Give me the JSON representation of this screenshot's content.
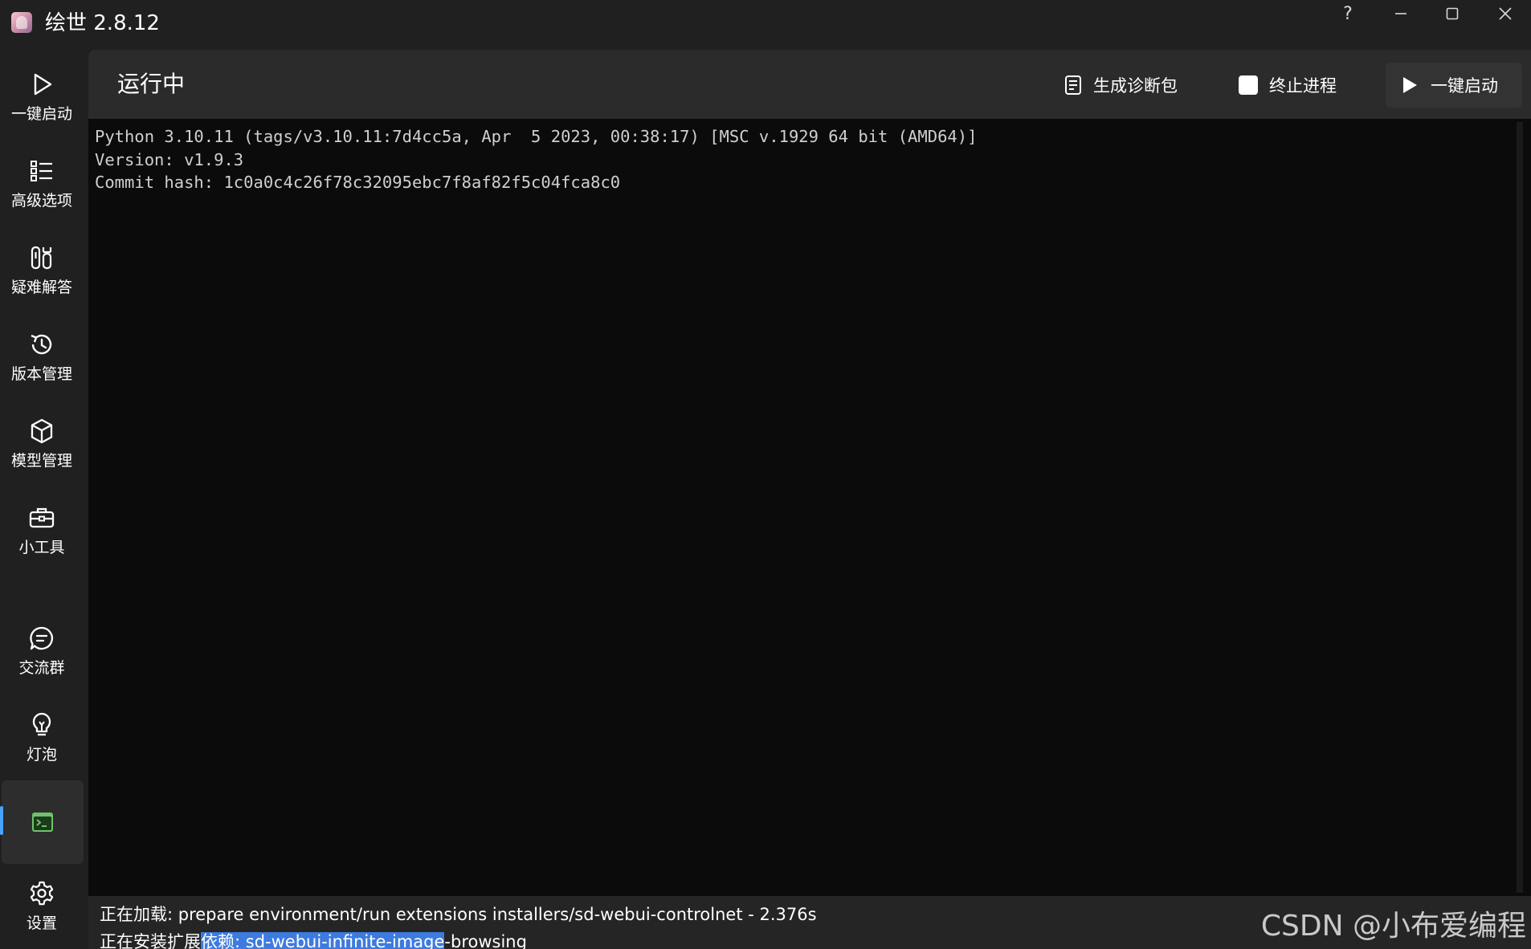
{
  "window": {
    "app_title": "绘世 2.8.12",
    "help_symbol": "?",
    "minimize_symbol": "—",
    "maximize_symbol": "□",
    "close_symbol": "✕"
  },
  "sidebar": {
    "items": [
      {
        "label": "一键启动",
        "icon": "play-icon"
      },
      {
        "label": "高级选项",
        "icon": "list-icon"
      },
      {
        "label": "疑难解答",
        "icon": "tools-icon"
      },
      {
        "label": "版本管理",
        "icon": "history-icon"
      },
      {
        "label": "模型管理",
        "icon": "cube-icon"
      },
      {
        "label": "小工具",
        "icon": "toolbox-icon"
      },
      {
        "label": "交流群",
        "icon": "chat-icon"
      },
      {
        "label": "灯泡",
        "icon": "lightbulb-icon"
      },
      {
        "label": "",
        "icon": "console-icon",
        "active": true
      },
      {
        "label": "设置",
        "icon": "gear-icon"
      }
    ]
  },
  "toolbar": {
    "title": "运行中",
    "diagnostics_label": "生成诊断包",
    "stop_label": "终止进程",
    "start_label": "一键启动"
  },
  "console": {
    "lines": [
      "Python 3.10.11 (tags/v3.10.11:7d4cc5a, Apr  5 2023, 00:38:17) [MSC v.1929 64 bit (AMD64)]",
      "Version: v1.9.3",
      "Commit hash: 1c0a0c4c26f78c32095ebc7f8af82f5c04fca8c0"
    ]
  },
  "status": {
    "line1": "正在加载: prepare environment/run extensions installers/sd-webui-controlnet - 2.376s",
    "line2_prefix": "正在安装扩展",
    "line2_highlight": "依赖: sd-webui-infinite-image",
    "line2_suffix": "-browsing"
  },
  "watermark": "CSDN @小布爱编程",
  "colors": {
    "accent": "#4aa3ff",
    "console_bg": "#0b0b0b",
    "console_icon": "#6fc26b",
    "highlight": "#3d7be0"
  }
}
